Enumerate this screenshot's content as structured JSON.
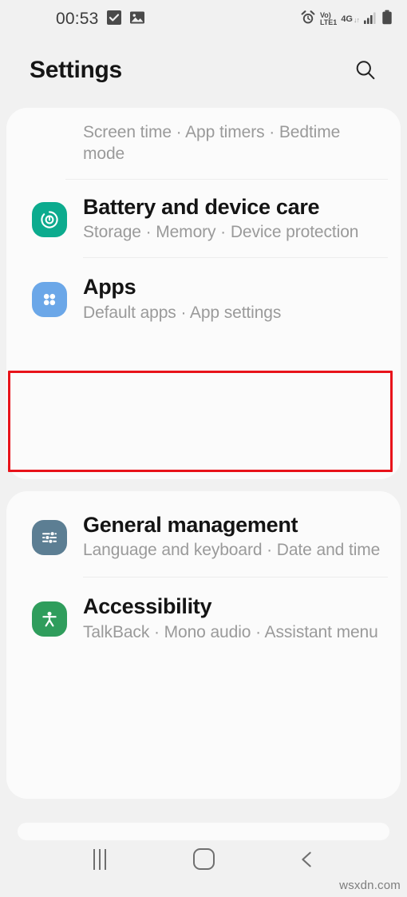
{
  "status_bar": {
    "time": "00:53",
    "left_icons": [
      {
        "name": "checkbox-filled-icon",
        "glyph": "check"
      },
      {
        "name": "image-icon",
        "glyph": "image"
      }
    ],
    "right_icons": [
      {
        "name": "alarm-icon",
        "glyph": "alarm"
      },
      {
        "name": "volte-icon",
        "line1": "Vo)",
        "line2": "LTE1"
      },
      {
        "name": "network-4g-icon",
        "label": "4G",
        "arrows": "↓↑"
      },
      {
        "name": "signal-bars-icon",
        "bars": 4
      },
      {
        "name": "battery-icon",
        "level": "full"
      }
    ]
  },
  "header": {
    "title": "Settings",
    "search_icon": "search-icon"
  },
  "cards": [
    {
      "id": "card-1",
      "rows": [
        {
          "name": "digital-wellbeing",
          "title": "",
          "subtitle": "Screen time · App timers · Bedtime mode",
          "icon": null,
          "clipped": true
        },
        {
          "name": "battery-and-device-care",
          "title": "Battery and device care",
          "subtitle": "Storage · Memory · Device protection",
          "icon": {
            "name": "battery-care-icon",
            "color": "#0cab8e",
            "glyph": "refresh-circle"
          }
        },
        {
          "name": "apps",
          "title": "Apps",
          "subtitle": "Default apps · App settings",
          "icon": {
            "name": "apps-grid-icon",
            "color": "#6ba7e8",
            "glyph": "four-dots"
          },
          "highlighted": true
        }
      ]
    },
    {
      "id": "card-2",
      "rows": [
        {
          "name": "general-management",
          "title": "General management",
          "subtitle": "Language and keyboard · Date and time",
          "icon": {
            "name": "sliders-icon",
            "color": "#5c7e93",
            "glyph": "sliders"
          }
        },
        {
          "name": "accessibility",
          "title": "Accessibility",
          "subtitle": "TalkBack · Mono audio · Assistant menu",
          "icon": {
            "name": "accessibility-person-icon",
            "color": "#2f9d5c",
            "glyph": "person"
          }
        }
      ]
    }
  ],
  "annotation": {
    "name": "red-highlight-box",
    "color": "#e8131a",
    "target": "apps"
  },
  "nav_bar": {
    "recents_label": "recents-icon",
    "home_label": "home-icon",
    "back_label": "back-icon"
  },
  "watermark": {
    "text": "wsxdn.com"
  }
}
